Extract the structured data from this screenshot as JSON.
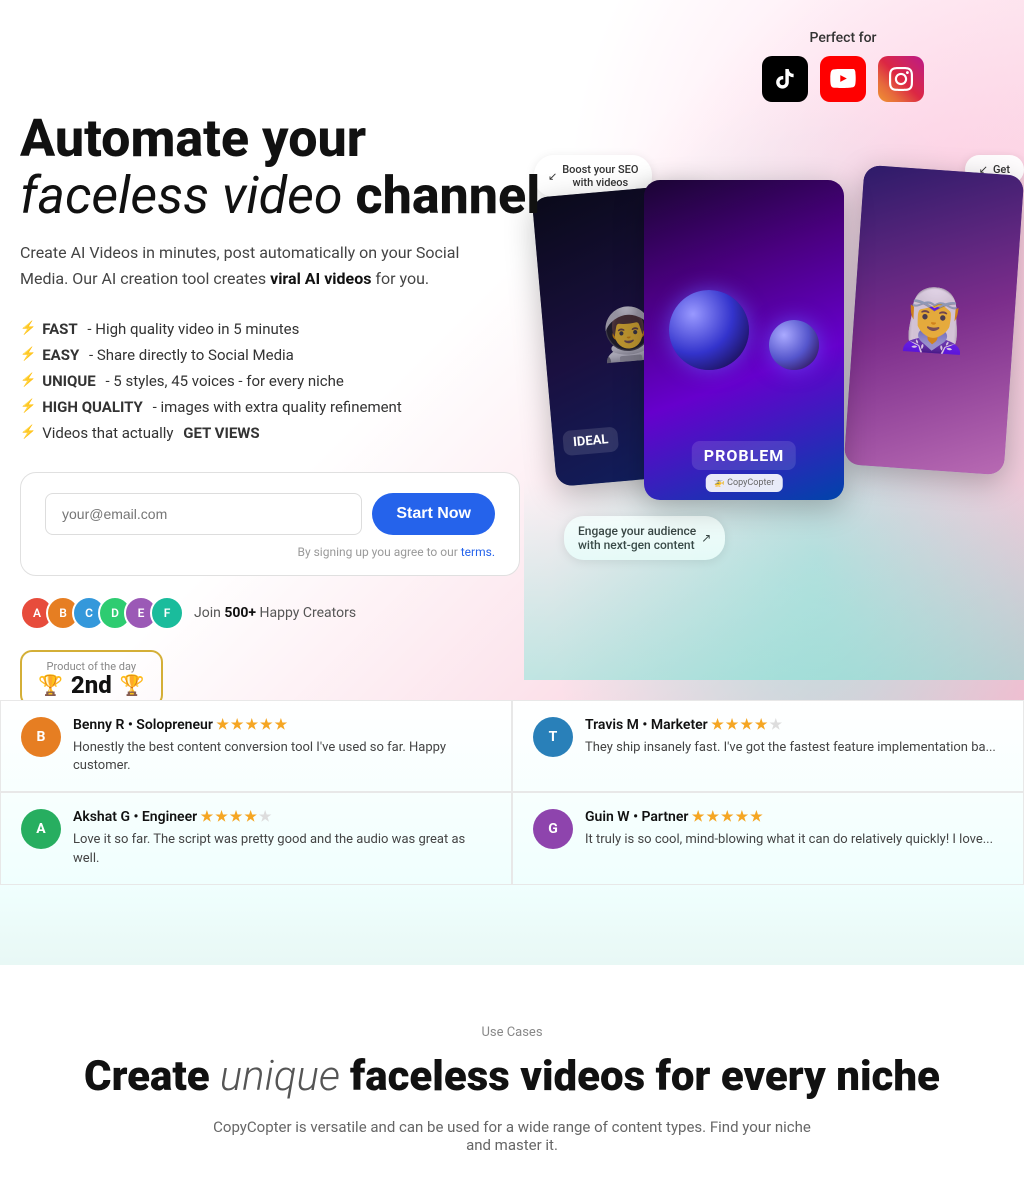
{
  "hero": {
    "heading_line1_bold": "Automate your",
    "heading_line2_normal": "faceless video",
    "heading_line2_bold": "channel",
    "subtitle_normal": "Create AI Videos in minutes, post automatically on your Social Media. Our AI creation tool creates ",
    "subtitle_highlight": "viral AI videos",
    "subtitle_end": " for you.",
    "features": [
      {
        "bold": "FAST",
        "text": " - High quality video in 5 minutes"
      },
      {
        "bold": "EASY",
        "text": " - Share directly to Social Media"
      },
      {
        "bold": "UNIQUE",
        "text": " - 5 styles, 45 voices - for every niche"
      },
      {
        "bold": "HIGH QUALITY",
        "text": " - images with extra quality refinement"
      },
      {
        "bold": "Videos that actually ",
        "text": "GET VIEWS",
        "last_bold": true
      }
    ],
    "email_placeholder": "your@email.com",
    "start_button": "Start Now",
    "terms_text": "By signing up you agree to our ",
    "terms_link": "terms.",
    "creators_count": "500+",
    "creators_label": "Happy Creators",
    "creators_prefix": "Join ",
    "perfect_for": "Perfect for",
    "card_problem_label": "PROBLEM",
    "card_ideal_label": "IDEAL",
    "boost_label": "Boost your SEO\nwith videos",
    "get_label": "Get ",
    "engage_label": "Engage your audience\nwith next-gen content",
    "copycopter_badge": "🚁 CopyCopter",
    "badge_title": "Product of the day",
    "badge_rank": "2nd"
  },
  "social_icons": {
    "tiktok": "TikTok",
    "youtube": "YouTube",
    "instagram": "Instagram"
  },
  "reviews": [
    {
      "name": "Benny R • Solopreneur",
      "stars": 5,
      "text": "Honestly the best content conversion tool I've used so far. Happy customer.",
      "color": "#e67e22",
      "initial": "B"
    },
    {
      "name": "Travis M • Marketer",
      "stars": 4.5,
      "text": "They ship insanely fast. I've got the fastest feature implementation ba...",
      "color": "#2980b9",
      "initial": "T"
    },
    {
      "name": "Akshat G • Engineer",
      "stars": 4.5,
      "text": "Love it so far. The script was pretty good and the audio was great as well.",
      "color": "#27ae60",
      "initial": "A"
    },
    {
      "name": "Guin W • Partner",
      "stars": 5,
      "text": "It truly is so cool, mind-blowing what it can do relatively quickly! I love...",
      "color": "#8e44ad",
      "initial": "G"
    }
  ],
  "use_cases": {
    "label": "Use Cases",
    "heading_bold1": "Create",
    "heading_normal": " unique ",
    "heading_bold2": "faceless videos for every niche",
    "subtitle": "CopyCopter is versatile and can be used for a wide range of content types. Find your niche and master it."
  },
  "avatars": [
    {
      "color": "#e74c3c",
      "initial": "A"
    },
    {
      "color": "#e67e22",
      "initial": "B"
    },
    {
      "color": "#3498db",
      "initial": "C"
    },
    {
      "color": "#2ecc71",
      "initial": "D"
    },
    {
      "color": "#9b59b6",
      "initial": "E"
    },
    {
      "color": "#1abc9c",
      "initial": "F"
    }
  ]
}
